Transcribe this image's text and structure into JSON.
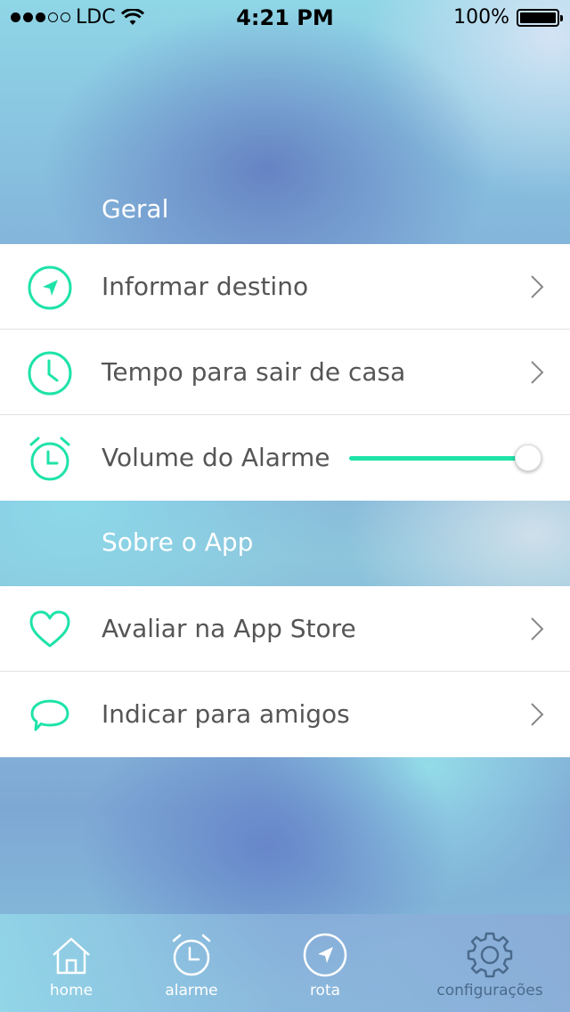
{
  "status_bar": {
    "carrier": "LDC",
    "time": "4:21 PM",
    "battery": "100%"
  },
  "sections": {
    "general": {
      "title": "Geral",
      "items": [
        {
          "label": "Informar destino",
          "icon": "navigation-arrow-icon"
        },
        {
          "label": "Tempo para sair de casa",
          "icon": "clock-icon"
        },
        {
          "label": "Volume do Alarme",
          "icon": "alarm-clock-icon",
          "slider_value": 1.0
        }
      ]
    },
    "about": {
      "title": "Sobre o App",
      "items": [
        {
          "label": "Avaliar na App Store",
          "icon": "heart-icon"
        },
        {
          "label": "Indicar para amigos",
          "icon": "speech-bubble-icon"
        }
      ]
    }
  },
  "tab_bar": {
    "tabs": [
      {
        "label": "home",
        "icon": "house-icon"
      },
      {
        "label": "alarme",
        "icon": "alarm-clock-icon"
      },
      {
        "label": "rota",
        "icon": "navigation-arrow-icon"
      },
      {
        "label": "configurações",
        "icon": "gear-icon",
        "active": true
      }
    ]
  },
  "colors": {
    "accent": "#1ee3a8",
    "row_text": "#555555",
    "active_tab": "#4a6a8c"
  }
}
